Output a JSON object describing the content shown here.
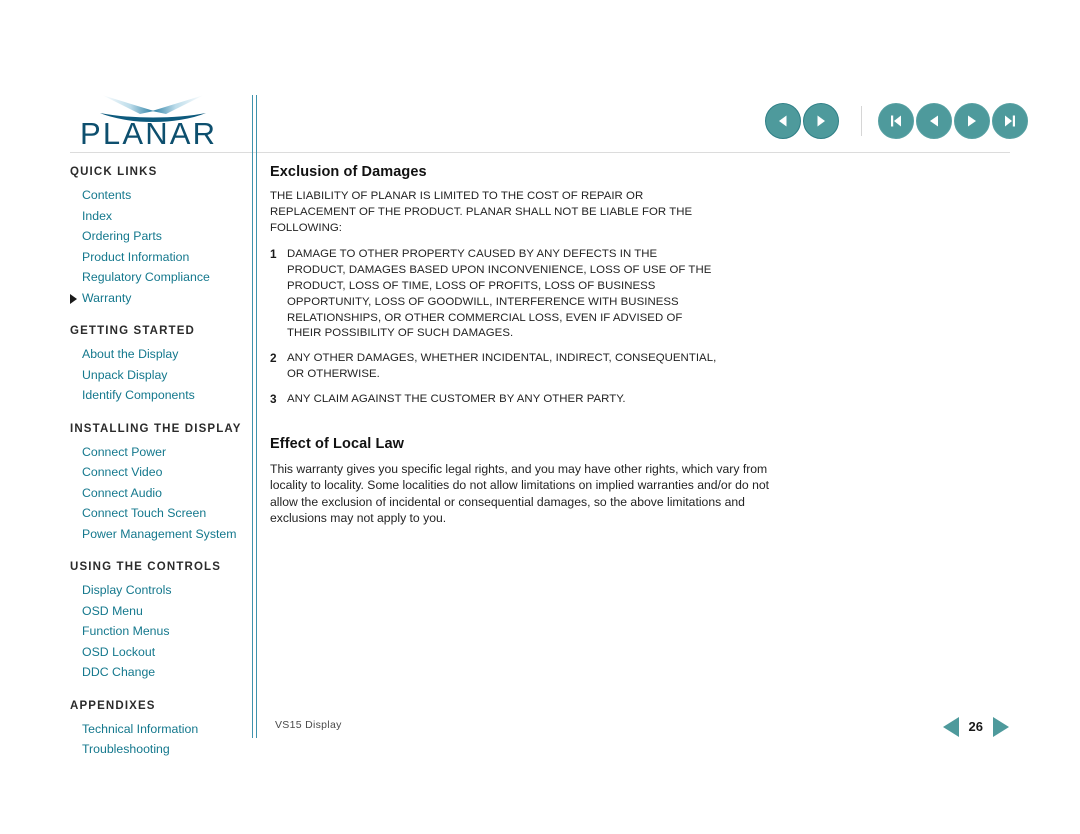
{
  "brand": {
    "logo_text": "PLANAR",
    "logo_mark": "swoosh-mark"
  },
  "topnav": {
    "buttons": [
      {
        "name": "back-button",
        "icon": "triangle-left-icon",
        "label": "Back"
      },
      {
        "name": "forward-button",
        "icon": "triangle-right-icon",
        "label": "Forward"
      },
      {
        "name": "first-page-button",
        "icon": "skip-to-first-icon",
        "label": "First page"
      },
      {
        "name": "previous-page-button",
        "icon": "triangle-left-icon",
        "label": "Previous page"
      },
      {
        "name": "next-page-button",
        "icon": "triangle-right-icon",
        "label": "Next page"
      },
      {
        "name": "last-page-button",
        "icon": "skip-to-last-icon",
        "label": "Last page"
      }
    ]
  },
  "sidebar": {
    "sections": [
      {
        "header": "QUICK LINKS",
        "items": [
          {
            "label": "Contents",
            "current": false
          },
          {
            "label": "Index",
            "current": false
          },
          {
            "label": "Ordering Parts",
            "current": false
          },
          {
            "label": "Product Information",
            "current": false
          },
          {
            "label": "Regulatory Compliance",
            "current": false
          },
          {
            "label": "Warranty",
            "current": true
          }
        ]
      },
      {
        "header": "GETTING STARTED",
        "items": [
          {
            "label": "About the Display",
            "current": false
          },
          {
            "label": "Unpack Display",
            "current": false
          },
          {
            "label": "Identify Components",
            "current": false
          }
        ]
      },
      {
        "header": "INSTALLING THE DISPLAY",
        "items": [
          {
            "label": "Connect Power",
            "current": false
          },
          {
            "label": "Connect Video",
            "current": false
          },
          {
            "label": "Connect Audio",
            "current": false
          },
          {
            "label": "Connect Touch Screen",
            "current": false
          },
          {
            "label": "Power Management System",
            "current": false
          }
        ]
      },
      {
        "header": "USING THE CONTROLS",
        "items": [
          {
            "label": "Display Controls",
            "current": false
          },
          {
            "label": "OSD Menu",
            "current": false
          },
          {
            "label": "Function Menus",
            "current": false
          },
          {
            "label": "OSD Lockout",
            "current": false
          },
          {
            "label": "DDC Change",
            "current": false
          }
        ]
      },
      {
        "header": "APPENDIXES",
        "items": [
          {
            "label": "Technical Information",
            "current": false
          },
          {
            "label": "Troubleshooting",
            "current": false
          }
        ]
      }
    ]
  },
  "content": {
    "section1": {
      "title": "Exclusion of Damages",
      "intro": "THE LIABILITY OF PLANAR IS LIMITED TO THE COST OF REPAIR OR REPLACEMENT OF THE PRODUCT. PLANAR SHALL NOT BE LIABLE FOR THE FOLLOWING:",
      "items": [
        {
          "number": "1",
          "text": "DAMAGE TO OTHER PROPERTY CAUSED BY ANY DEFECTS IN THE PRODUCT, DAMAGES BASED UPON INCONVENIENCE, LOSS OF USE OF THE PRODUCT, LOSS OF TIME, LOSS OF PROFITS, LOSS OF BUSINESS OPPORTUNITY, LOSS OF GOODWILL, INTERFERENCE WITH BUSINESS RELATIONSHIPS, OR OTHER COMMERCIAL LOSS, EVEN IF ADVISED OF THEIR POSSIBILITY OF SUCH DAMAGES."
        },
        {
          "number": "2",
          "text": "ANY OTHER DAMAGES, WHETHER INCIDENTAL, INDIRECT, CONSEQUENTIAL, OR OTHERWISE."
        },
        {
          "number": "3",
          "text": "ANY CLAIM AGAINST THE CUSTOMER BY ANY OTHER PARTY."
        }
      ]
    },
    "section2": {
      "title": "Effect of Local Law",
      "paragraph": "This warranty gives you specific legal rights, and you may have other rights, which vary from locality to locality. Some localities do not allow limitations on implied warranties and/or do not allow the exclusion of incidental or consequential damages, so the above limitations and exclusions may not apply to you."
    }
  },
  "footer": {
    "document_label": "VS15 Display",
    "page_number": "26",
    "prev_icon": "triangle-left-icon",
    "next_icon": "triangle-right-icon"
  },
  "colors": {
    "link_teal": "#14788d",
    "button_teal": "#4e9a9c",
    "button_teal_border": "#2f7f86",
    "logo_navy": "#0d4f6e",
    "rule_grey": "#dcdcdc",
    "vrule_teal": "#3f93ad",
    "pager_teal": "#4e9a9c"
  }
}
